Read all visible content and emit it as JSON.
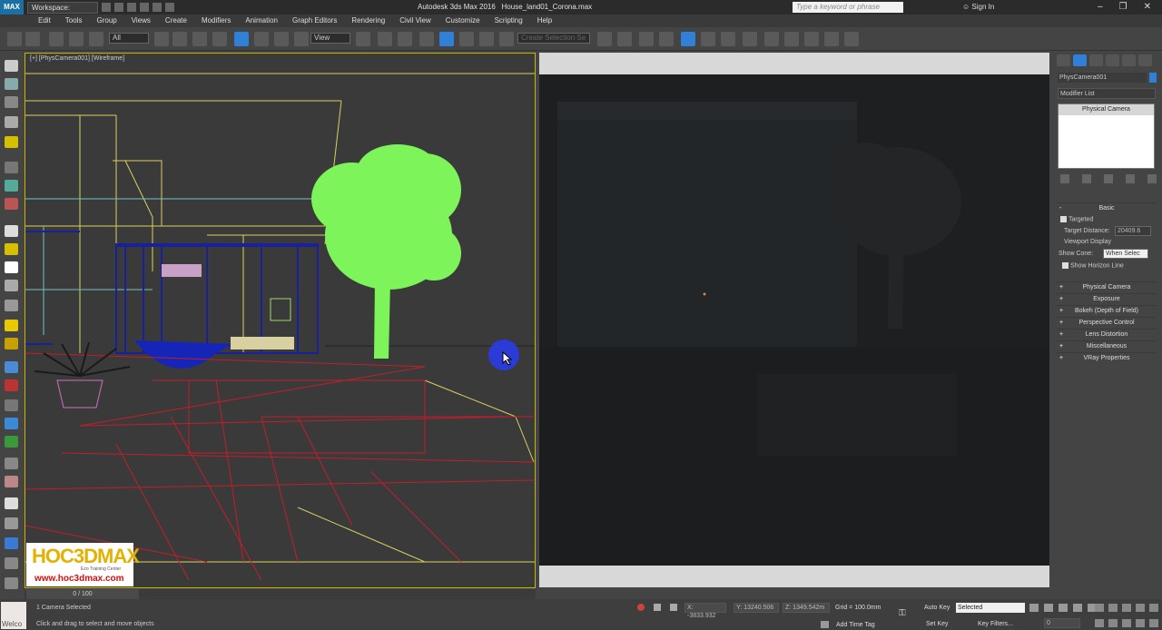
{
  "title_bar": {
    "logo": "MAX",
    "workspace_label": "Workspace: Default",
    "app_title": "Autodesk 3ds Max 2016",
    "file_name": "House_land01_Corona.max",
    "search_placeholder": "Type a keyword or phrase",
    "sign_in": "Sign In"
  },
  "menu": [
    "Edit",
    "Tools",
    "Group",
    "Views",
    "Create",
    "Modifiers",
    "Animation",
    "Graph Editors",
    "Rendering",
    "Civil View",
    "Customize",
    "Scripting",
    "Help"
  ],
  "toolbar": {
    "filter_value": "All",
    "ref_coord_value": "View",
    "named_selection_placeholder": "Create Selection Se"
  },
  "viewport_left": {
    "label": "[+] [PhysCamera001] [Wireframe]"
  },
  "command_panel": {
    "object_name": "PhysCamera001",
    "modifier_list": "Modifier List",
    "stack_item": "Physical Camera",
    "basic_title": "Basic",
    "targeted_label": "Targeted",
    "target_distance_label": "Target Distance:",
    "target_distance_value": "20409.6",
    "viewport_display_label": "Viewport Display",
    "show_cone_label": "Show Cone:",
    "show_cone_value": "When Selec",
    "show_horizon_label": "Show Horizon Line",
    "rollouts": [
      "Physical Camera",
      "Exposure",
      "Bokeh (Depth of Field)",
      "Perspective Control",
      "Lens Distortion",
      "Miscellaneous",
      "VRay Properties"
    ]
  },
  "timeline": {
    "slider_text": "0 / 100"
  },
  "status_bar": {
    "welcome": "Welco",
    "selection_info": "1 Camera Selected",
    "prompt": "Click and drag to select and move objects",
    "x_value": "-3833.932",
    "y_value": "13240.506",
    "z_value": "1349.542m",
    "grid": "Grid = 100.0mm",
    "add_time_tag": "Add Time Tag",
    "auto_key": "Auto Key",
    "set_key": "Set Key",
    "key_mode": "Selected",
    "key_filters": "Key Filters...",
    "frame": "0"
  },
  "watermark": {
    "brand": "HOC3DMAX",
    "tagline": "Ezo Training Center",
    "url": "www.hoc3dmax.com"
  },
  "colors": {
    "viewport_border_active": "#c8b600",
    "tree_green": "#7df55a",
    "wire_red": "#c21e2a",
    "wire_yellow": "#d8d060",
    "wire_blue": "#18209a",
    "render_bg": "#1d1f21"
  }
}
